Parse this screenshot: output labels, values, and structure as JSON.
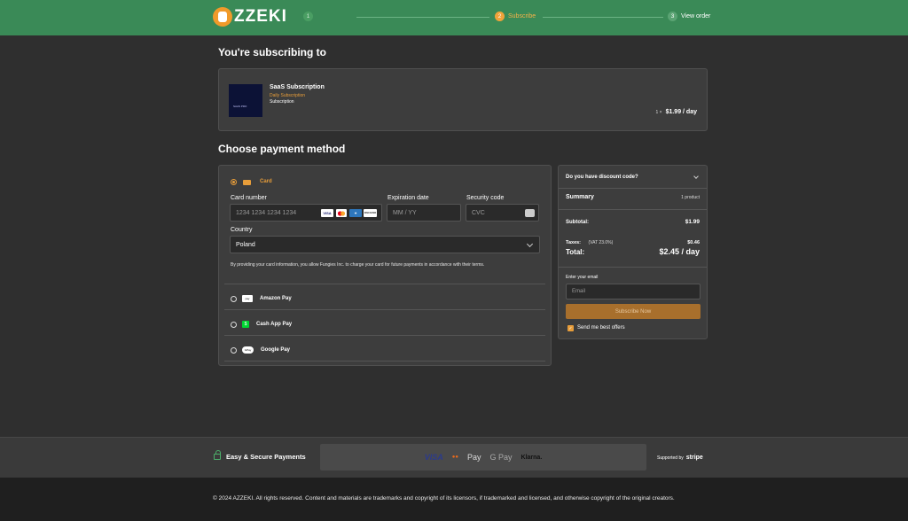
{
  "header": {
    "logo_text": "ZZEKI",
    "steps": [
      {
        "num": "1",
        "label": ""
      },
      {
        "num": "2",
        "label": "Subscribe"
      },
      {
        "num": "3",
        "label": "View order"
      }
    ]
  },
  "subscription": {
    "heading": "You're subscribing to",
    "thumb_text": "SAAS PRO",
    "title": "SaaS Subscription",
    "period": "Daily Subscription",
    "type": "Subscription",
    "quantity": "1 ×",
    "price": "$1.99 / day"
  },
  "payment": {
    "heading": "Choose payment method",
    "card_label": "Card",
    "card_number_label": "Card number",
    "card_number_placeholder": "1234 1234 1234 1234",
    "brands": [
      "VISA",
      "MC",
      "AMEX",
      "DISCOVER"
    ],
    "expiration_label": "Expiration date",
    "expiration_placeholder": "MM / YY",
    "security_label": "Security code",
    "security_placeholder": "CVC",
    "country_label": "Country",
    "country_value": "Poland",
    "terms": "By providing your card information, you allow Fungies Inc. to charge your card for future payments in accordance with their terms.",
    "methods": [
      {
        "label": "Amazon Pay",
        "logo": "pay"
      },
      {
        "label": "Cash App Pay",
        "logo": "$"
      },
      {
        "label": "Google Pay",
        "logo": "GPay"
      }
    ]
  },
  "summary": {
    "discount_question": "Do you have discount code?",
    "title": "Summary",
    "product_count": "1 product",
    "subtotal_label": "Subtotal:",
    "subtotal_value": "$1.99",
    "taxes_label": "Taxes:",
    "taxes_rate": "(VAT 23.0%)",
    "taxes_value": "$0.46",
    "total_label": "Total:",
    "total_value": "$2.45 / day",
    "email_label": "Enter your email",
    "email_placeholder": "Email",
    "subscribe_button": "Subscribe Now",
    "offers_label": "Send me best offers"
  },
  "footer": {
    "secure_text": "Easy & Secure Payments",
    "payment_logos": [
      "VISA",
      "●●",
      "Pay",
      "G Pay",
      "Klarna."
    ],
    "supported_by": "Supported by",
    "supported_brand": "stripe",
    "copyright": "© 2024 AZZEKI. All rights reserved. Content and materials are trademarks and copyright of its licensors, if trademarked and licensed, and otherwise copyright of the original creators."
  },
  "colors": {
    "header_bg": "#3a8a57",
    "accent": "#e79d3a",
    "button_bg": "#a86f2c"
  }
}
